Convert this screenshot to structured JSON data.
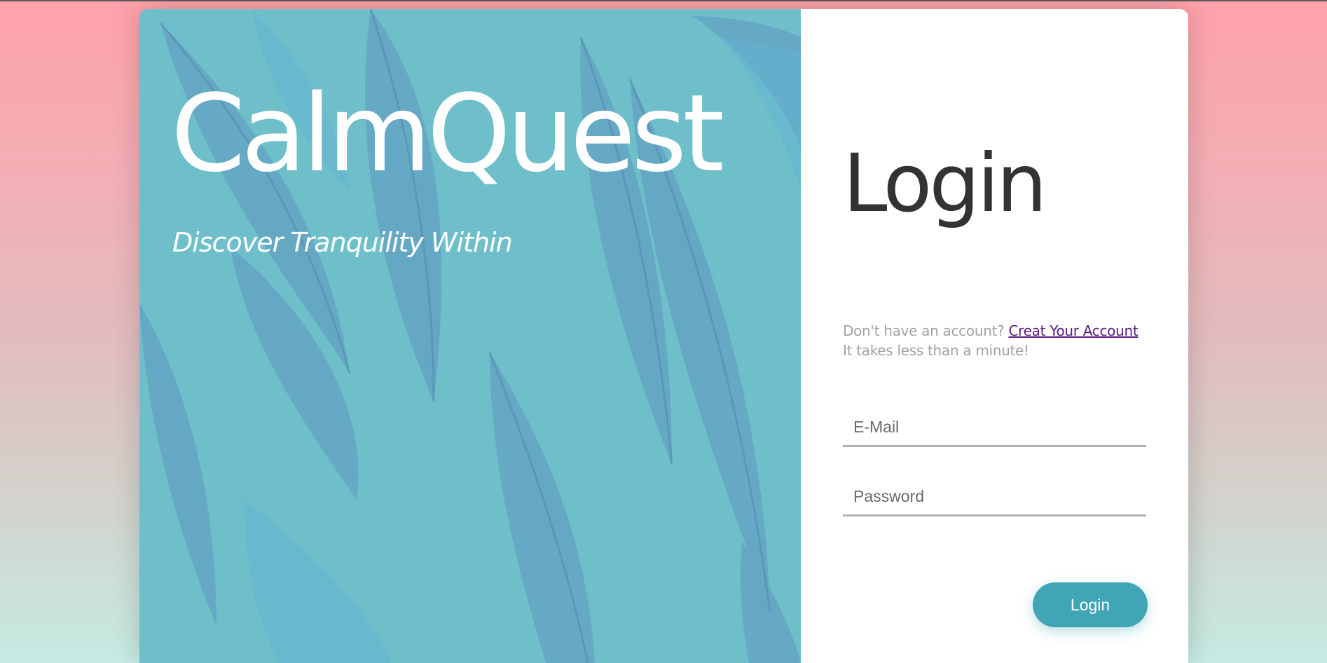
{
  "colors": {
    "hero_background": "#6fbfcb",
    "accent": "#40a5b5",
    "link": "#5c1b7c",
    "title_text": "#333333",
    "muted_text": "#a2a2a2"
  },
  "hero": {
    "brand": "CalmQuest",
    "tagline": "Discover Tranquility Within",
    "background_icon": "feathers-pattern"
  },
  "login": {
    "title": "Login",
    "signup_prompt": "Don't have an account?",
    "signup_link": "Creat Your Account",
    "signup_note": "It takes less than a minute!",
    "email": {
      "placeholder": "E-Mail",
      "value": ""
    },
    "password": {
      "placeholder": "Password",
      "value": ""
    },
    "submit_label": "Login"
  }
}
